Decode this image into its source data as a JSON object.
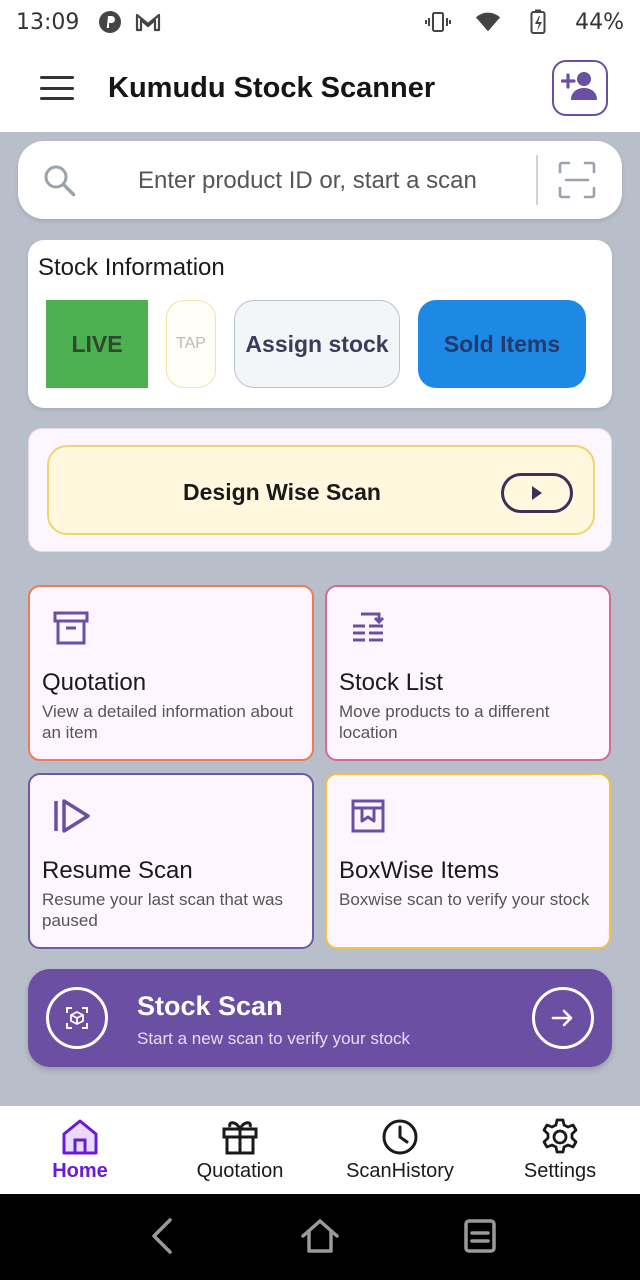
{
  "status_bar": {
    "time": "13:09",
    "battery": "44%",
    "icons": [
      "pinterest-icon",
      "gmail-icon",
      "vibrate-icon",
      "wifi-icon",
      "battery-icon"
    ]
  },
  "app_bar": {
    "title": "Kumudu Stock Scanner",
    "icons": [
      "menu-icon",
      "add-user-icon"
    ]
  },
  "search": {
    "placeholder": "Enter product ID or, start a scan",
    "icons": [
      "search-icon",
      "scan-frame-icon"
    ]
  },
  "stock_info": {
    "title": "Stock Information",
    "buttons": {
      "live": "LIVE",
      "tap": "TAP",
      "assign": "Assign stock",
      "sold": "Sold Items"
    }
  },
  "design_wise": {
    "label": "Design Wise Scan",
    "icon": "play-icon"
  },
  "tiles": [
    {
      "title": "Quotation",
      "desc": "View a detailed information about an item",
      "icon": "archive-box-icon"
    },
    {
      "title": "Stock List",
      "desc": "Move products to a different location",
      "icon": "list-transfer-icon"
    },
    {
      "title": "Resume Scan",
      "desc": "Resume your last scan that was paused",
      "icon": "resume-play-icon"
    },
    {
      "title": "BoxWise Items",
      "desc": "Boxwise scan to verify your stock",
      "icon": "box-bookmark-icon"
    }
  ],
  "stock_scan": {
    "title": "Stock Scan",
    "subtitle": "Start a new scan to verify your stock",
    "icons": [
      "cube-scan-icon",
      "arrow-right-icon"
    ]
  },
  "bottom_nav": [
    {
      "label": "Home",
      "icon": "home-icon",
      "active": true
    },
    {
      "label": "Quotation",
      "icon": "gift-icon",
      "active": false
    },
    {
      "label": "ScanHistory",
      "icon": "clock-icon",
      "active": false
    },
    {
      "label": "Settings",
      "icon": "gear-icon",
      "active": false
    }
  ],
  "colors": {
    "accent": "#6a4fa3",
    "live": "#4caf50",
    "sold": "#1e88e5",
    "nav_active": "#6a1bd8",
    "background": "#b9bfca"
  }
}
